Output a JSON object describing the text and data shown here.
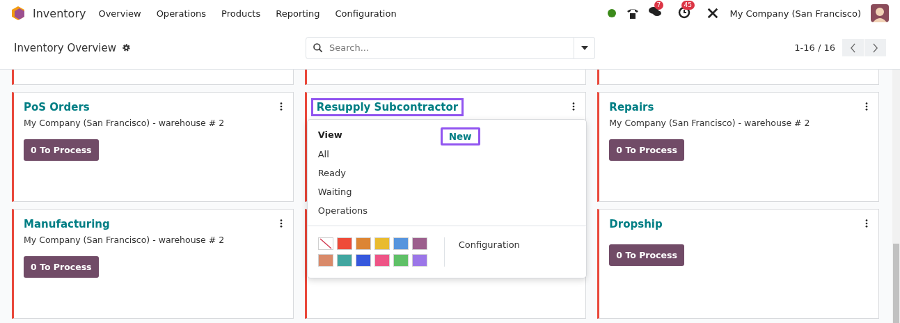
{
  "navbar": {
    "app_name": "Inventory",
    "menu": [
      "Overview",
      "Operations",
      "Products",
      "Reporting",
      "Configuration"
    ],
    "chat_badge": "7",
    "activity_badge": "45",
    "company": "My Company (San Francisco)"
  },
  "control_panel": {
    "title": "Inventory Overview",
    "search": {
      "placeholder": "Search..."
    },
    "pager": "1-16 / 16"
  },
  "cards": [
    {
      "kind": "operation",
      "title": "PoS Orders",
      "subtitle": "My Company (San Francisco) - warehouse # 2",
      "button": "0 To Process",
      "highlighted": false
    },
    {
      "kind": "operation",
      "title": "Resupply Subcontractor",
      "highlighted": true,
      "menu": {
        "heading": "View",
        "items": [
          "All",
          "Ready",
          "Waiting",
          "Operations"
        ],
        "new_label": "New",
        "new_highlighted": true,
        "configuration": "Configuration",
        "colors": [
          {
            "kind": "none",
            "color": "#ffffff"
          },
          {
            "kind": "swatch",
            "color": "#ee4b39"
          },
          {
            "kind": "swatch",
            "color": "#dc8534"
          },
          {
            "kind": "swatch",
            "color": "#e9bb2f"
          },
          {
            "kind": "swatch",
            "color": "#5694dd"
          },
          {
            "kind": "swatch",
            "color": "#9c5f8d"
          },
          {
            "kind": "swatch",
            "color": "#d98a6a"
          },
          {
            "kind": "swatch",
            "color": "#41a6a0"
          },
          {
            "kind": "swatch",
            "color": "#3658dd"
          },
          {
            "kind": "swatch",
            "color": "#ee5486"
          },
          {
            "kind": "swatch",
            "color": "#5fc067"
          },
          {
            "kind": "swatch",
            "color": "#9b76e8"
          }
        ]
      }
    },
    {
      "kind": "operation",
      "title": "Repairs",
      "subtitle": "My Company (San Francisco) - warehouse # 2",
      "button": "0 To Process",
      "highlighted": false
    },
    {
      "kind": "operation",
      "title": "Manufacturing",
      "subtitle": "My Company (San Francisco) - warehouse # 2",
      "button": "0 To Process",
      "highlighted": false
    },
    {
      "kind": "covered"
    },
    {
      "kind": "operation",
      "title": "Dropship",
      "button": "0 To Process",
      "highlighted": false
    }
  ]
}
